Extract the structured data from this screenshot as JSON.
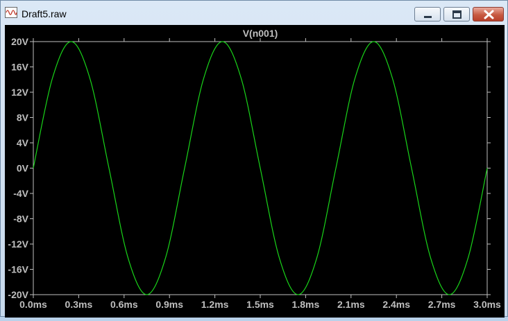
{
  "window": {
    "title": "Draft5.raw",
    "icon": "waveform-icon"
  },
  "controls": {
    "minimize": "minimize-icon",
    "maximize": "maximize-icon",
    "close": "close-icon"
  },
  "colors": {
    "background": "#000000",
    "axes": "#c0c0c0",
    "trace": "#19d419",
    "title": "#19d419",
    "ticks": "#bfbfbf"
  },
  "chart_data": {
    "type": "line",
    "title": "V(n001)",
    "xlabel": "",
    "ylabel": "",
    "x_tick_labels": [
      "0.0ms",
      "0.3ms",
      "0.6ms",
      "0.9ms",
      "1.2ms",
      "1.5ms",
      "1.8ms",
      "2.1ms",
      "2.4ms",
      "2.7ms",
      "3.0ms"
    ],
    "y_tick_labels": [
      "20V",
      "16V",
      "12V",
      "8V",
      "4V",
      "0V",
      "-4V",
      "-8V",
      "-12V",
      "-16V",
      "-20V"
    ],
    "xlim": [
      0,
      3.0
    ],
    "ylim": [
      -20,
      20
    ],
    "x_unit": "ms",
    "y_unit": "V",
    "grid": false,
    "series": [
      {
        "name": "V(n001)",
        "color": "#19d419",
        "x": [
          0.0,
          0.125,
          0.25,
          0.375,
          0.5,
          0.625,
          0.75,
          0.875,
          1.0,
          1.125,
          1.25,
          1.375,
          1.5,
          1.625,
          1.75,
          1.875,
          2.0,
          2.125,
          2.25,
          2.375,
          2.5,
          2.625,
          2.75,
          2.875,
          3.0
        ],
        "y": [
          0,
          14.1,
          20,
          14.1,
          0,
          -14.1,
          -20,
          -14.1,
          0,
          14.1,
          20,
          14.1,
          0,
          -14.1,
          -20,
          -14.1,
          0,
          14.1,
          20,
          14.1,
          0,
          -14.1,
          -20,
          -14.1,
          0
        ]
      }
    ]
  }
}
